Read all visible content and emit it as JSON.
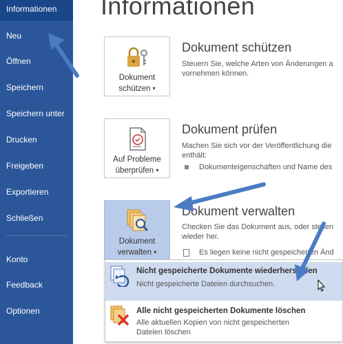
{
  "sidebar": {
    "items": [
      {
        "label": "Informationen",
        "active": true
      },
      {
        "label": "Neu"
      },
      {
        "label": "Öffnen"
      },
      {
        "label": "Speichern"
      },
      {
        "label": "Speichern unter"
      },
      {
        "label": "Drucken"
      },
      {
        "label": "Freigeben"
      },
      {
        "label": "Exportieren"
      },
      {
        "label": "Schließen"
      },
      {
        "label": "Konto"
      },
      {
        "label": "Feedback"
      },
      {
        "label": "Optionen"
      }
    ]
  },
  "main": {
    "title": "Informationen",
    "sections": [
      {
        "button_line1": "Dokument",
        "button_line2": "schützen",
        "title": "Dokument schützen",
        "desc_line1": "Steuern Sie, welche Arten von Änderungen a",
        "desc_line2": "vornehmen können."
      },
      {
        "button_line1": "Auf Probleme",
        "button_line2": "überprüfen",
        "title": "Dokument prüfen",
        "desc_line1": "Machen Sie sich vor der Veröffentlichung die",
        "desc_line2": "enthält:",
        "bullet": "Dokumenteigenschaften und Name des"
      },
      {
        "button_line1": "Dokument",
        "button_line2": "verwalten",
        "title": "Dokument verwalten",
        "desc_line1": "Checken Sie das Dokument aus, oder stellen",
        "desc_line2": "wieder her.",
        "note": "Es liegen keine nicht gespeicherten Änd"
      }
    ]
  },
  "dropdown": {
    "items": [
      {
        "title": "Nicht gespeicherte Dokumente wiederherstellen",
        "subtitle": "Nicht gespeicherte Dateien durchsuchen.",
        "icon": "recover-documents-icon"
      },
      {
        "title": "Alle nicht gespeicherten Dokumente löschen",
        "subtitle_line1": "Alle aktuellen Kopien von nicht gespeicherten",
        "subtitle_line2": "Dateien löschen",
        "icon": "delete-documents-icon"
      }
    ]
  },
  "colors": {
    "sidebar": "#2b579a",
    "sidebar_active": "#19478a",
    "pressed_button": "#b8cbe9",
    "menu_hover": "#cfdcef",
    "annotation_arrow": "#4a7cc4"
  }
}
